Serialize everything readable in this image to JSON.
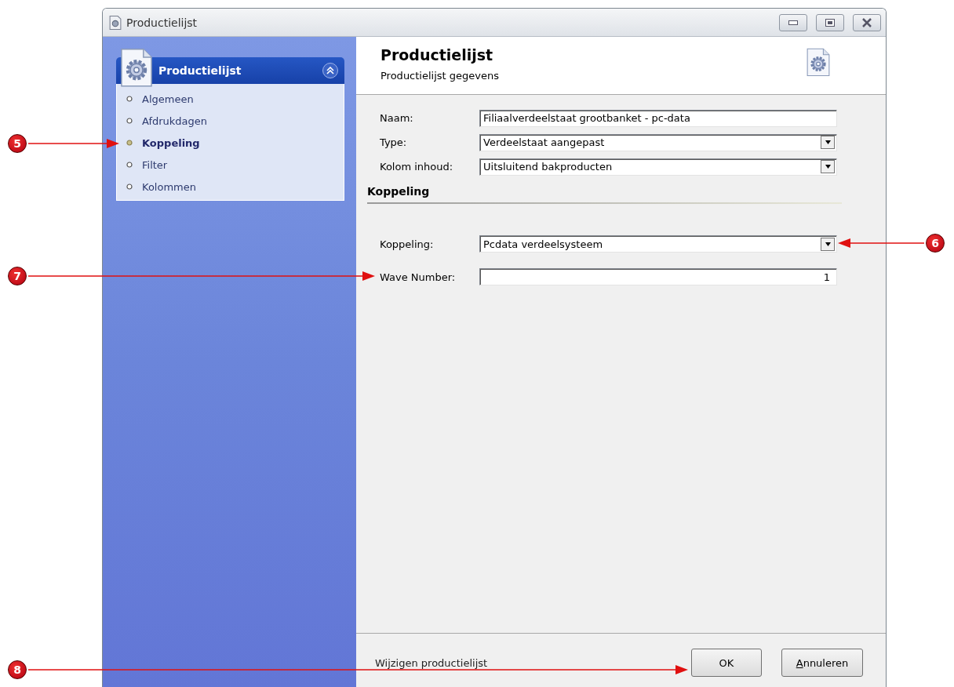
{
  "window": {
    "title": "Productielijst"
  },
  "sidebar": {
    "panel_title": "Productielijst",
    "expanded": true,
    "items": [
      {
        "label": "Algemeen",
        "selected": false
      },
      {
        "label": "Afdrukdagen",
        "selected": false
      },
      {
        "label": "Koppeling",
        "selected": true
      },
      {
        "label": "Filter",
        "selected": false
      },
      {
        "label": "Kolommen",
        "selected": false
      }
    ]
  },
  "header": {
    "title": "Productielijst",
    "subtitle": "Productielijst gegevens"
  },
  "fields": [
    {
      "label": "Naam:",
      "value": "Filiaalverdeelstaat grootbanket - pc-data",
      "kind": "text"
    },
    {
      "label": "Type:",
      "value": "Verdeelstaat aangepast",
      "kind": "dropdown"
    },
    {
      "label": "Kolom inhoud:",
      "value": "Uitsluitend bakproducten",
      "kind": "dropdown"
    }
  ],
  "section": {
    "title": "Koppeling",
    "fields": [
      {
        "label": "Koppeling:",
        "value": "Pcdata verdeelsysteem",
        "kind": "dropdown"
      },
      {
        "label": "Wave Number:",
        "value": "1",
        "kind": "number"
      }
    ]
  },
  "footer": {
    "status": "Wijzigen productielijst",
    "buttons": [
      "OK",
      "Annuleren"
    ]
  },
  "annotations": [
    {
      "number": "5"
    },
    {
      "number": "6"
    },
    {
      "number": "7"
    },
    {
      "number": "8"
    }
  ]
}
